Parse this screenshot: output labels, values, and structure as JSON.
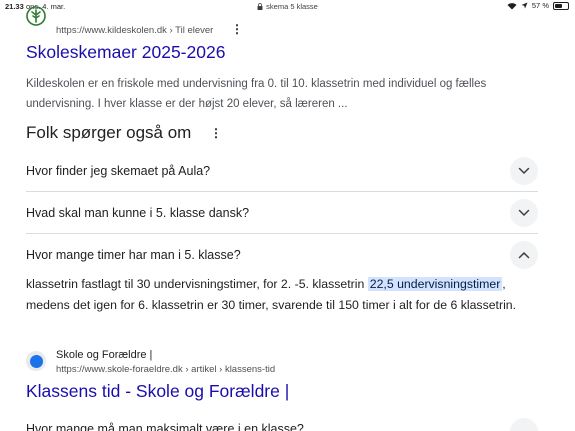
{
  "status_bar": {
    "time": "21.33",
    "date": "ons. 4. mar.",
    "url": "skema 5 klasse",
    "battery": "57 %",
    "battery_level": 0.57
  },
  "result1": {
    "url": "https://www.kildeskolen.dk › Til elever",
    "title": "Skoleskemaer 2025-2026",
    "snippet": "Kildeskolen er en friskole med undervisning fra 0. til 10. klassetrin med individuel og fælles undervisning. I hver klasse er der højst 20 elever, så læreren ..."
  },
  "people_also_ask": {
    "title": "Folk spørger også om",
    "questions": [
      "Hvor finder jeg skemaet på Aula?",
      "Hvad skal man kunne i 5. klasse dansk?",
      "Hvor mange timer har man i 5. klasse?"
    ],
    "answer": {
      "before": "klassetrin fastlagt til 30 undervisningstimer, for 2. -5. klassetrin ",
      "highlight": "22,5 undervisningstimer",
      "after": ", medens det igen for 6. klassetrin er 30 timer, svarende til 150 timer i alt for de 6 klassetrin."
    },
    "source": {
      "name": "Skole og Forældre |",
      "url": "https://www.skole-foraeldre.dk › artikel › klassens-tid",
      "title": "Klassens tid - Skole og Forældre |"
    },
    "next_question_partial": "Hvor mange må man maksimalt være i en klasse?"
  },
  "colors": {
    "link": "#1a0dab",
    "highlight": "#d3e3fd",
    "chevron_bg": "#f1f3f4"
  }
}
